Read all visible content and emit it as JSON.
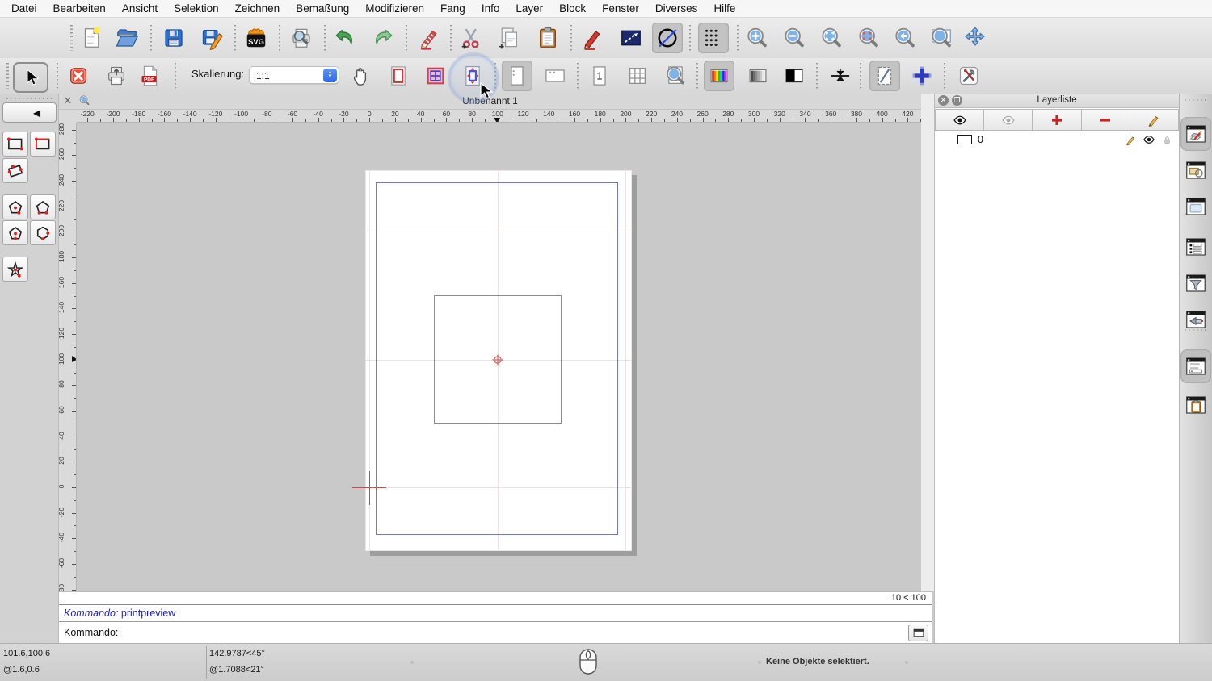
{
  "menu_bar": {
    "items": [
      "Datei",
      "Bearbeiten",
      "Ansicht",
      "Selektion",
      "Zeichnen",
      "Bemaßung",
      "Modifizieren",
      "Fang",
      "Info",
      "Layer",
      "Block",
      "Fenster",
      "Diverses",
      "Hilfe"
    ]
  },
  "toolbar_main": {
    "items": [
      {
        "type": "icon",
        "name": "new-document"
      },
      {
        "type": "icon",
        "name": "open"
      },
      {
        "type": "icon",
        "name": "save"
      },
      {
        "type": "icon",
        "name": "save-as"
      },
      {
        "type": "icon",
        "name": "svg-export"
      },
      {
        "type": "icon",
        "name": "print-preview"
      },
      {
        "type": "icon",
        "name": "undo"
      },
      {
        "type": "icon",
        "name": "redo"
      },
      {
        "type": "icon",
        "name": "edit-pencil"
      },
      {
        "type": "icon",
        "name": "cut"
      },
      {
        "type": "icon",
        "name": "copy"
      },
      {
        "type": "icon",
        "name": "paste"
      },
      {
        "type": "icon",
        "name": "drawing-preferences"
      },
      {
        "type": "icon",
        "name": "measure"
      },
      {
        "type": "icon",
        "name": "auto-zoom",
        "active": true
      },
      {
        "type": "icon",
        "name": "grid-toggle",
        "active": true
      },
      {
        "type": "icon",
        "name": "zoom-in"
      },
      {
        "type": "icon",
        "name": "zoom-out"
      },
      {
        "type": "icon",
        "name": "zoom-auto"
      },
      {
        "type": "icon",
        "name": "zoom-selection"
      },
      {
        "type": "icon",
        "name": "zoom-previous"
      },
      {
        "type": "icon",
        "name": "zoom-window"
      },
      {
        "type": "icon",
        "name": "auto-pan"
      }
    ]
  },
  "toolbar_preview": {
    "scaling_label": "Skalierung:",
    "scaling_value": "1:1",
    "items": [
      {
        "type": "icon",
        "name": "close-preview"
      },
      {
        "type": "icon",
        "name": "print"
      },
      {
        "type": "icon",
        "name": "pdf-export"
      },
      {
        "type": "icon",
        "name": "hand-pan"
      },
      {
        "type": "icon",
        "name": "page-border"
      },
      {
        "type": "icon",
        "name": "multi-pages"
      },
      {
        "type": "icon",
        "name": "fit-page",
        "highlighted": true
      },
      {
        "type": "icon",
        "name": "portrait",
        "active": true
      },
      {
        "type": "icon",
        "name": "landscape"
      },
      {
        "type": "icon",
        "name": "single-page"
      },
      {
        "type": "icon",
        "name": "tiled-pages"
      },
      {
        "type": "icon",
        "name": "zoom-page"
      },
      {
        "type": "icon",
        "name": "color-mode",
        "active": true
      },
      {
        "type": "icon",
        "name": "grayscale-mode"
      },
      {
        "type": "icon",
        "name": "blackwhite-mode"
      },
      {
        "type": "icon",
        "name": "fit-scale"
      },
      {
        "type": "icon",
        "name": "draft-mode",
        "active": true
      },
      {
        "type": "icon",
        "name": "crosshair"
      },
      {
        "type": "icon",
        "name": "app-settings"
      }
    ]
  },
  "left_tools": {
    "tools": [
      "rect-two-corners",
      "rect-corner-size",
      "rect-three-points",
      "polygon-center-vertex",
      "polygon-two-vertices",
      "polygon-center-side",
      "polygon-side-side",
      "star"
    ]
  },
  "document": {
    "title": "Unbenannt 1",
    "grid_status": "10 < 100"
  },
  "rulers": {
    "horizontal": {
      "ticks": [
        -220,
        -200,
        -180,
        -160,
        -140,
        -120,
        -100,
        -80,
        -60,
        -40,
        -20,
        0,
        20,
        40,
        60,
        80,
        100,
        120,
        140,
        160,
        180,
        200,
        220,
        240,
        260,
        280,
        300,
        320,
        340,
        360,
        380,
        400,
        420
      ],
      "marker": 100
    },
    "vertical": {
      "ticks": [
        280,
        260,
        240,
        220,
        200,
        180,
        160,
        140,
        120,
        100,
        80,
        60,
        40,
        20,
        0,
        -20,
        -40,
        -60,
        -80
      ],
      "marker": 100
    }
  },
  "layer_panel": {
    "title": "Layerliste",
    "toolbar": [
      "show-all-layers",
      "hide-all-layers",
      "add-layer",
      "remove-layer",
      "edit-layer"
    ],
    "layers": [
      {
        "name": "0"
      }
    ]
  },
  "dock": {
    "items": [
      "layer-list",
      "block-list",
      "library-browser",
      "property-list",
      "selection-filter",
      "cam-view",
      "command-line",
      "clipboard-panel"
    ],
    "active": [
      "layer-list",
      "command-line"
    ]
  },
  "command_area": {
    "history_label": "Kommando:",
    "history_command": "printpreview",
    "prompt_label": "Kommando:",
    "input_value": ""
  },
  "status_bar": {
    "abs_coord": "101.6,100.6",
    "rel_coord": "@1.6,0.6",
    "abs_polar": "142.9787<45°",
    "rel_polar": "@1.7088<21°",
    "selection_status": "Keine Objekte selektiert."
  },
  "colors": {
    "accent_blue": "#2f6be4",
    "margin_blue": "#7473d6",
    "marker_red": "#e04343",
    "layer_red": "#cc2222",
    "canvas_gray": "#c9c9c9"
  }
}
